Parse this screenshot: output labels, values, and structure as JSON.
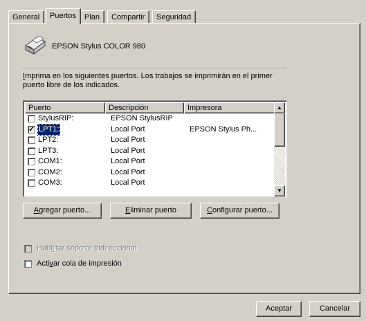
{
  "tabs": [
    {
      "label": "General"
    },
    {
      "label": "Puertos"
    },
    {
      "label": "Plan"
    },
    {
      "label": "Compartir"
    },
    {
      "label": "Seguridad"
    }
  ],
  "printer": {
    "name": "EPSON Stylus COLOR 980",
    "icon": "printer-icon"
  },
  "description": {
    "line1_accel": "I",
    "line1_rest": "mprima en los siguientes puertos. Los trabajos se imprimirán en el primer",
    "line2": "puerto libre de los indicados."
  },
  "ports": {
    "columns": [
      "Puerto",
      "Descripción",
      "Impresora"
    ],
    "rows": [
      {
        "checked": false,
        "port": "StylusRIP:",
        "description": "EPSON StylusRIP",
        "printer": ""
      },
      {
        "checked": true,
        "port": "LPT1:",
        "description": "Local Port",
        "printer": "EPSON Stylus Ph..."
      },
      {
        "checked": false,
        "port": "LPT2:",
        "description": "Local Port",
        "printer": ""
      },
      {
        "checked": false,
        "port": "LPT3:",
        "description": "Local Port",
        "printer": ""
      },
      {
        "checked": false,
        "port": "COM1:",
        "description": "Local Port",
        "printer": ""
      },
      {
        "checked": false,
        "port": "COM2:",
        "description": "Local Port",
        "printer": ""
      },
      {
        "checked": false,
        "port": "COM3:",
        "description": "Local Port",
        "printer": ""
      }
    ],
    "selected_index": 1
  },
  "buttons": {
    "add": {
      "accel": "A",
      "rest": "gregar puerto..."
    },
    "delete": {
      "accel": "E",
      "rest": "liminar puerto"
    },
    "configure": {
      "accel": "C",
      "rest": "onfigurar puerto..."
    }
  },
  "options": {
    "bidirectional": {
      "pre": "Habi",
      "accel": "l",
      "post": "itar soporte bidireccional",
      "checked": false,
      "enabled": false
    },
    "spool": {
      "pre": "Acti",
      "accel": "v",
      "post": "ar cola de impresión",
      "checked": false,
      "enabled": true
    }
  },
  "dialog": {
    "ok": "Aceptar",
    "cancel": "Cancelar"
  },
  "colors": {
    "face": "#d4d0c8",
    "selection": "#0a246a",
    "disabled_text": "#808080"
  }
}
